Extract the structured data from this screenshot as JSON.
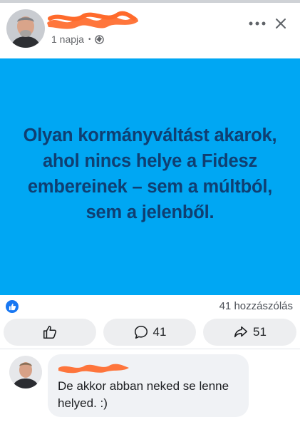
{
  "post": {
    "time": "1 napja",
    "separator": "•",
    "privacy_icon": "globe-icon",
    "text": "Olyan kormányváltást akarok, ahol nincs helye a Fidesz embereinek – sem a múltból, sem a jelenből.",
    "background_color": "#00a7f3",
    "text_color": "#0f3f72"
  },
  "header": {
    "more_icon": "more-dots-icon",
    "close_icon": "close-icon"
  },
  "reactions": {
    "like_icon": "like-icon",
    "comment_count_label": "41 hozzászólás"
  },
  "actions": {
    "like_icon": "thumbs-up-icon",
    "comment_count": "41",
    "share_count": "51"
  },
  "comment": {
    "text": "De akkor abban neked se lenne helyed. :)"
  },
  "colors": {
    "redaction": "#ff6a2b",
    "facebook_blue": "#1877f2"
  }
}
